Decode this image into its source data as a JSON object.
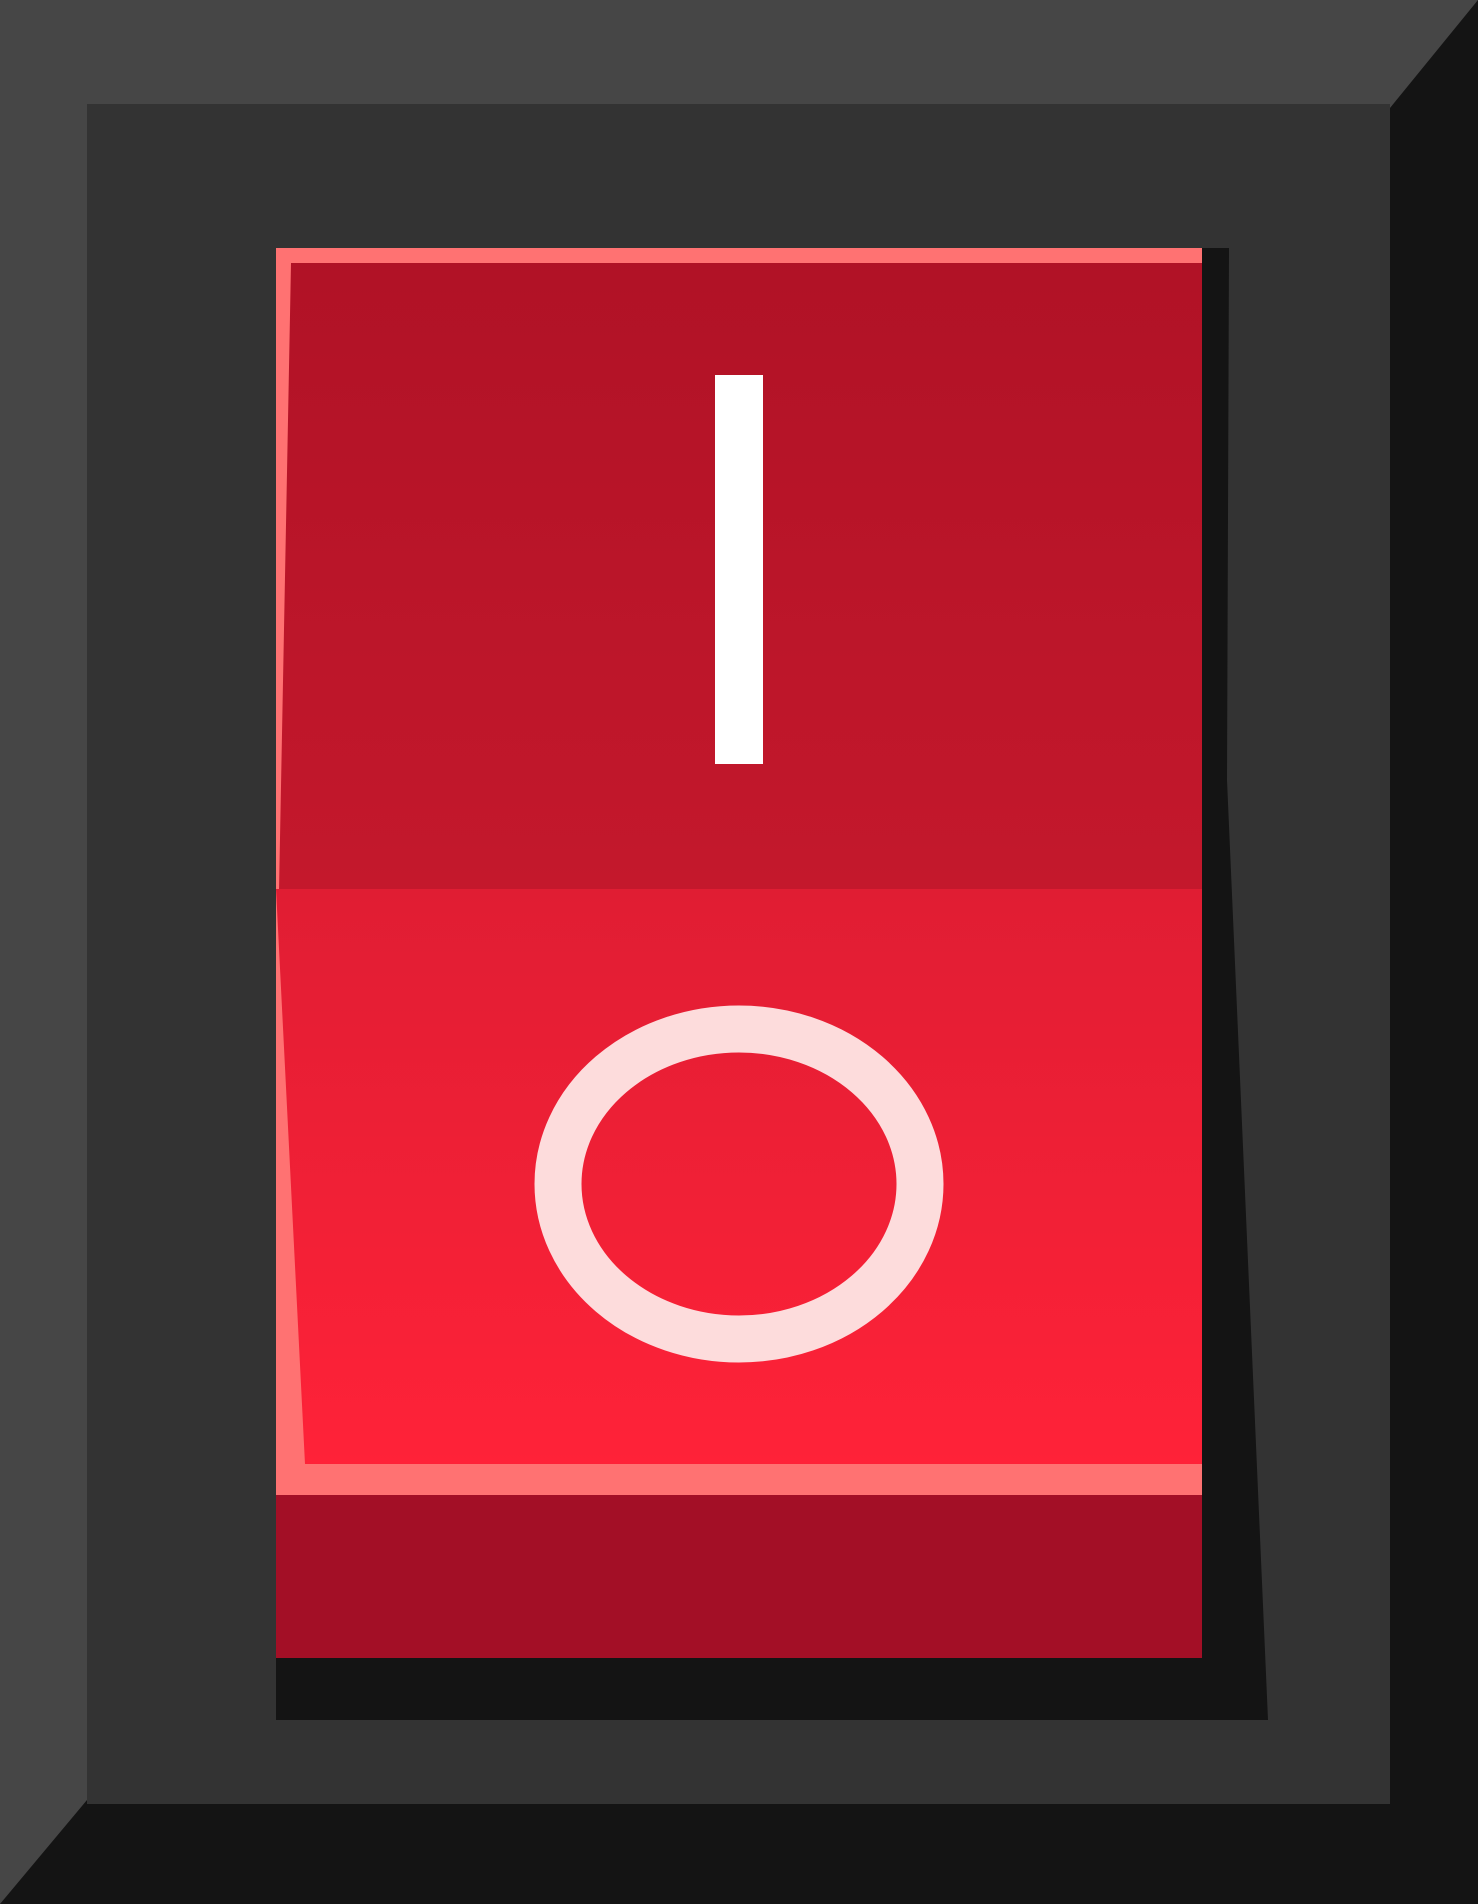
{
  "rocker_switch": {
    "state": "off",
    "on_symbol": "I",
    "off_symbol": "O",
    "colors": {
      "bezel_light": "#464646",
      "bezel_dark": "#141414",
      "bezel_face": "#333333",
      "rocker_top_dark": "#b01226",
      "rocker_top_light": "#c4182c",
      "rocker_bottom_dark": "#e01d33",
      "rocker_bottom_light": "#ff2238",
      "rocker_edge_highlight": "#ff7272",
      "rocker_base": "#a30f26",
      "symbol_on": "#ffffff",
      "symbol_off": "#fddcdc"
    }
  }
}
